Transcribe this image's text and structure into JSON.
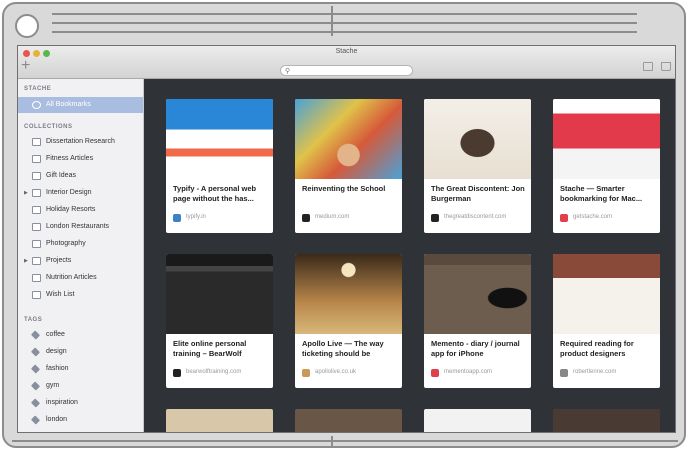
{
  "window": {
    "title": "Stache"
  },
  "search": {
    "placeholder": ""
  },
  "sidebar": {
    "stache_header": "STACHE",
    "all_bookmarks": "All Bookmarks",
    "collections_header": "COLLECTIONS",
    "collections": [
      "Dissertation Research",
      "Fitness Articles",
      "Gift Ideas",
      "Interior Design",
      "Holiday Resorts",
      "London Restaurants",
      "Photography",
      "Projects",
      "Nutrition Articles",
      "Wish List"
    ],
    "tags_header": "TAGS",
    "tags": [
      "coffee",
      "design",
      "fashion",
      "gym",
      "inspiration",
      "london"
    ]
  },
  "cards": [
    {
      "title": "Typify - A personal web page without the has...",
      "domain": "typify.in",
      "fav_color": "#3b82c4"
    },
    {
      "title": "Reinventing the School",
      "domain": "medium.com",
      "fav_color": "#222222"
    },
    {
      "title": "The Great Discontent: Jon Burgerman",
      "domain": "thegreatdiscontent.com",
      "fav_color": "#222222"
    },
    {
      "title": "Stache — Smarter bookmarking for Mac...",
      "domain": "getstache.com",
      "fav_color": "#e0404a"
    },
    {
      "title": "Elite online personal training – BearWolf",
      "domain": "bearwolftraining.com",
      "fav_color": "#222222"
    },
    {
      "title": "Apollo Live — The way ticketing should be",
      "domain": "apollolive.co.uk",
      "fav_color": "#c89a5a"
    },
    {
      "title": "Memento - diary / journal app for iPhone",
      "domain": "mementoapp.com",
      "fav_color": "#e0404a"
    },
    {
      "title": "Required reading for product designers",
      "domain": "robertlenne.com",
      "fav_color": "#888888"
    }
  ]
}
